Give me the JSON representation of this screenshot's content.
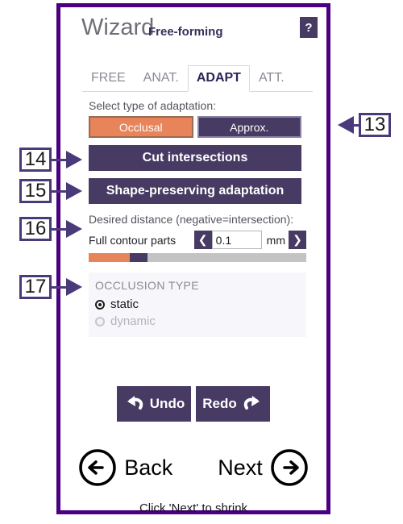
{
  "window": {
    "title": "Wizard",
    "subtitle": "Free-forming",
    "help_label": "?",
    "border_color": "#4B0082"
  },
  "tabs": [
    {
      "label": "FREE",
      "active": false
    },
    {
      "label": "ANAT.",
      "active": false
    },
    {
      "label": "ADAPT",
      "active": true
    },
    {
      "label": "ATT.",
      "active": false
    }
  ],
  "adaptation": {
    "section_label": "Select type of adaptation:",
    "options": [
      {
        "label": "Occlusal",
        "selected": true,
        "color": "#E8845A"
      },
      {
        "label": "Approx.",
        "selected": false,
        "color": "#473A63"
      }
    ],
    "cut_intersections_label": "Cut intersections",
    "shape_preserving_label": "Shape-preserving adaptation"
  },
  "distance": {
    "section_label": "Desired distance (negative=intersection):",
    "name": "Full contour parts",
    "value": "0.1",
    "placeholder": "0.0",
    "unit": "mm",
    "decrement_icon": "chevron-left-icon",
    "increment_icon": "chevron-right-icon",
    "bar": {
      "orange_percent": 19,
      "purple_percent": 8,
      "track_color": "#C3C3C3"
    }
  },
  "occlusion": {
    "heading": "OCCLUSION TYPE",
    "options": [
      {
        "label": "static",
        "selected": true,
        "disabled": false
      },
      {
        "label": "dynamic",
        "selected": false,
        "disabled": true
      }
    ]
  },
  "history": {
    "undo_label": "Undo",
    "redo_label": "Redo",
    "undo_icon": "undo-arrow-icon",
    "redo_icon": "redo-arrow-icon"
  },
  "navigation": {
    "back_label": "Back",
    "next_label": "Next",
    "back_icon": "arrow-left-circle-icon",
    "next_icon": "arrow-right-circle-icon",
    "hint": "Click 'Next' to shrink"
  },
  "callouts": [
    {
      "number": "13",
      "direction": "left"
    },
    {
      "number": "14",
      "direction": "right"
    },
    {
      "number": "15",
      "direction": "right"
    },
    {
      "number": "16",
      "direction": "right"
    },
    {
      "number": "17",
      "direction": "right"
    }
  ]
}
